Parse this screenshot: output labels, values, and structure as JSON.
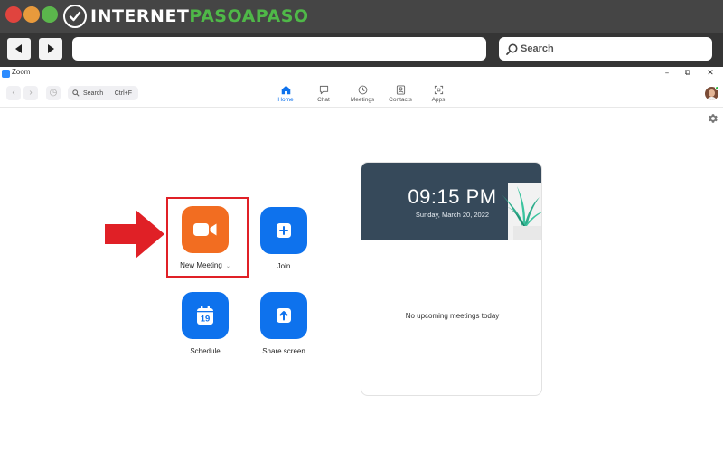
{
  "browser": {
    "brand": {
      "part1": "INTERNET",
      "part2": "PASOAPASO"
    },
    "url": "",
    "search_label": "Search"
  },
  "zoom": {
    "window_title": "Zoom",
    "search": {
      "label": "Search",
      "shortcut": "Ctrl+F"
    },
    "tabs": [
      {
        "label": "Home",
        "icon": "home-icon",
        "active": true
      },
      {
        "label": "Chat",
        "icon": "chat-icon",
        "active": false
      },
      {
        "label": "Meetings",
        "icon": "clock-icon",
        "active": false
      },
      {
        "label": "Contacts",
        "icon": "contacts-icon",
        "active": false
      },
      {
        "label": "Apps",
        "icon": "apps-icon",
        "active": false
      }
    ],
    "actions": {
      "new_meeting": "New Meeting",
      "join": "Join",
      "schedule": "Schedule",
      "schedule_day": "19",
      "share_screen": "Share screen"
    },
    "clock": {
      "time": "09:15 PM",
      "date": "Sunday, March 20, 2022"
    },
    "upcoming_empty": "No upcoming meetings today"
  },
  "colors": {
    "zoom_blue": "#0e72ed",
    "new_meeting_orange": "#f26d21",
    "highlight_red": "#e02026",
    "card_header": "#36495a",
    "brand_green": "#4fb848"
  }
}
